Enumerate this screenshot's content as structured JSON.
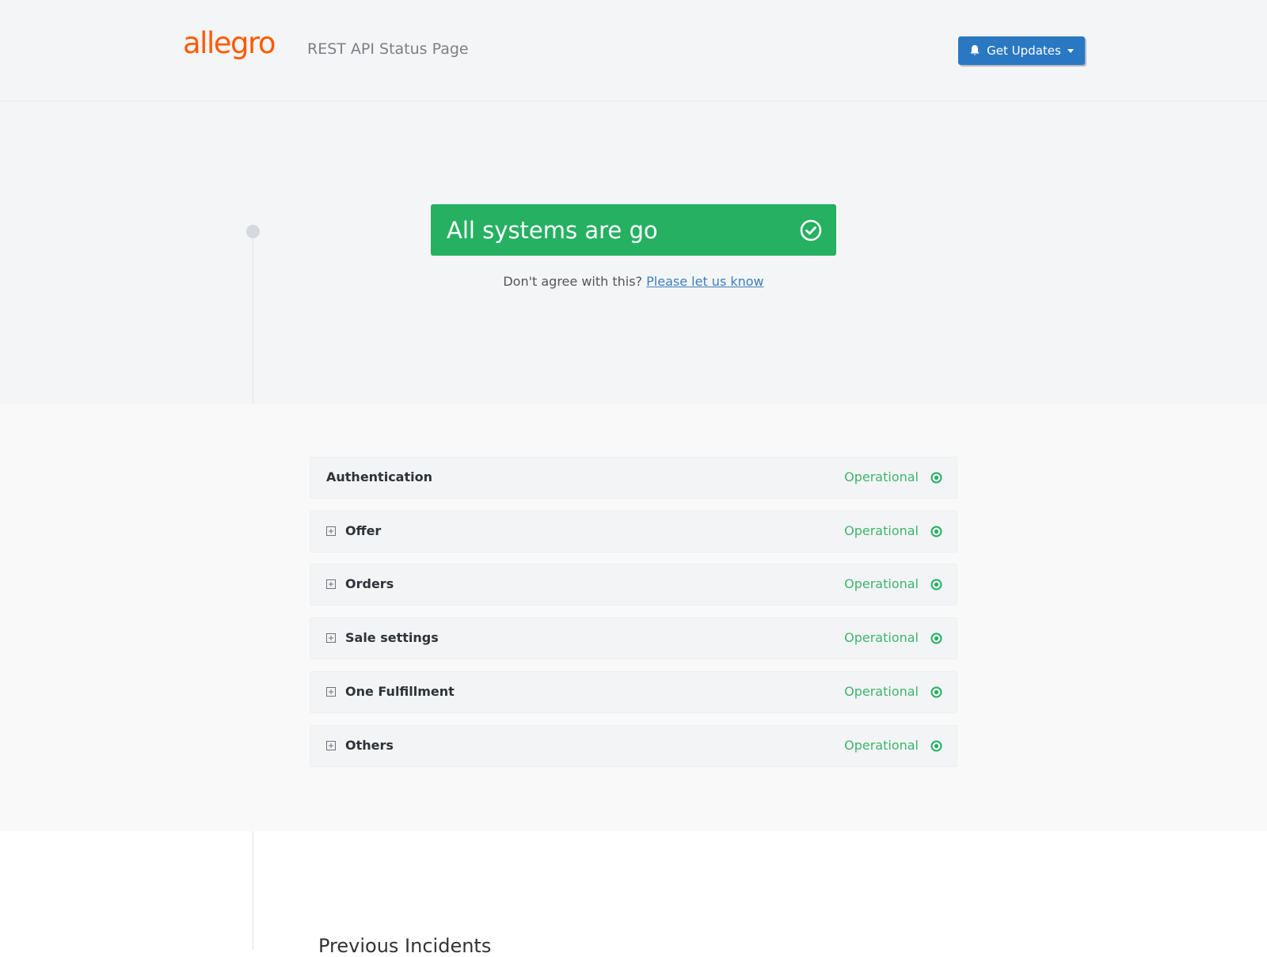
{
  "header": {
    "logo_text": "allegro",
    "page_title": "REST API Status Page",
    "get_updates_label": "Get Updates",
    "brand_color": "#ff5a00",
    "button_color": "#2a78c2"
  },
  "hero": {
    "status_text": "All systems are go",
    "status_color": "#26b062",
    "disagree_text": "Don't agree with this?",
    "disagree_link": "Please let us know"
  },
  "components": [
    {
      "name": "Authentication",
      "state": "Operational",
      "expandable": false
    },
    {
      "name": "Offer",
      "state": "Operational",
      "expandable": true
    },
    {
      "name": "Orders",
      "state": "Operational",
      "expandable": true
    },
    {
      "name": "Sale settings",
      "state": "Operational",
      "expandable": true
    },
    {
      "name": "One Fulfillment",
      "state": "Operational",
      "expandable": true
    },
    {
      "name": "Others",
      "state": "Operational",
      "expandable": true
    }
  ],
  "operational_color": "#3db56b",
  "previous_incidents_heading": "Previous Incidents"
}
